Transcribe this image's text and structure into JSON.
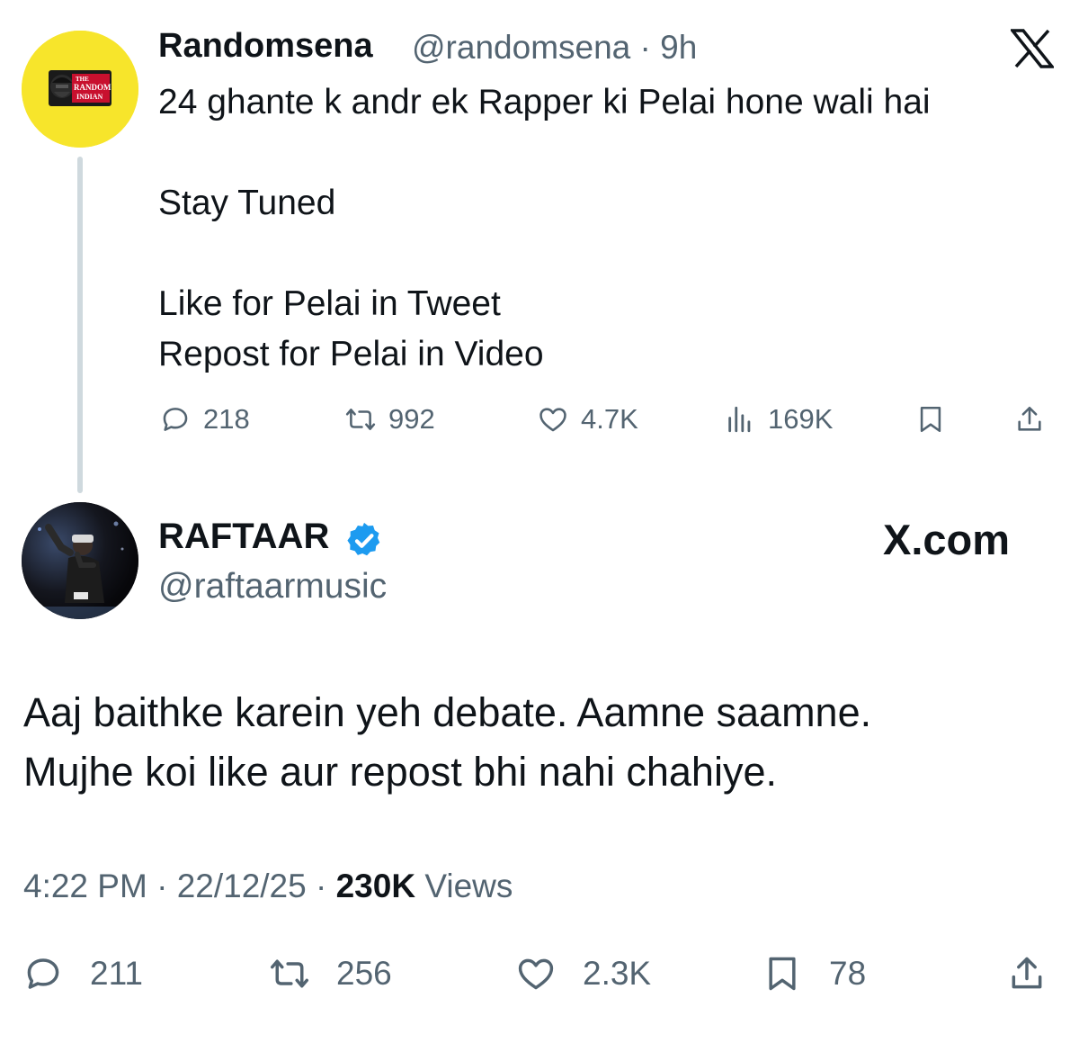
{
  "parent_tweet": {
    "author_name": "Randomsena",
    "handle_time": "@randomsena · 9h",
    "avatar_text": [
      "THE",
      "RANDOM",
      "INDIAN"
    ],
    "lines": [
      "24 ghante k andr ek Rapper ki Pelai hone wali hai",
      "Stay Tuned",
      "Like for Pelai in Tweet",
      "Repost for Pelai in Video"
    ],
    "actions": {
      "replies": "218",
      "reposts": "992",
      "likes": "4.7K",
      "views": "169K"
    }
  },
  "main_tweet": {
    "author_name": "RAFTAAR",
    "verified": true,
    "handle": "@raftaarmusic",
    "watermark": "X.com",
    "lines": [
      "Aaj baithke karein yeh debate. Aamne saamne.",
      "Mujhe koi like aur repost bhi nahi chahiye."
    ],
    "meta": {
      "time": "4:22 PM",
      "date": "22/12/25",
      "views_count": "230K",
      "views_label": "Views"
    },
    "actions": {
      "replies": "211",
      "reposts": "256",
      "likes": "2.3K",
      "bookmarks": "78"
    }
  },
  "colors": {
    "text": "#0f1419",
    "secondary": "#536471",
    "verified_blue": "#1d9bf0",
    "avatar_yellow": "#f7e52b",
    "thread_line": "#cfd9de"
  }
}
